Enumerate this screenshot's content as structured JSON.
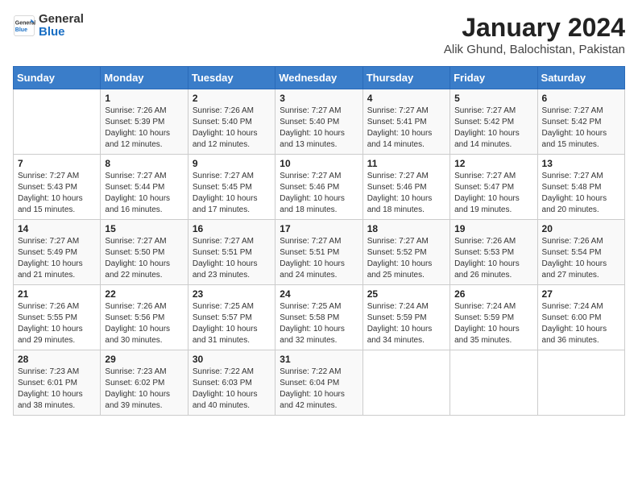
{
  "header": {
    "logo_general": "General",
    "logo_blue": "Blue",
    "month": "January 2024",
    "location": "Alik Ghund, Balochistan, Pakistan"
  },
  "weekdays": [
    "Sunday",
    "Monday",
    "Tuesday",
    "Wednesday",
    "Thursday",
    "Friday",
    "Saturday"
  ],
  "weeks": [
    [
      {
        "day": "",
        "sunrise": "",
        "sunset": "",
        "daylight": ""
      },
      {
        "day": "1",
        "sunrise": "7:26 AM",
        "sunset": "5:39 PM",
        "daylight": "10 hours and 12 minutes."
      },
      {
        "day": "2",
        "sunrise": "7:26 AM",
        "sunset": "5:40 PM",
        "daylight": "10 hours and 12 minutes."
      },
      {
        "day": "3",
        "sunrise": "7:27 AM",
        "sunset": "5:40 PM",
        "daylight": "10 hours and 13 minutes."
      },
      {
        "day": "4",
        "sunrise": "7:27 AM",
        "sunset": "5:41 PM",
        "daylight": "10 hours and 14 minutes."
      },
      {
        "day": "5",
        "sunrise": "7:27 AM",
        "sunset": "5:42 PM",
        "daylight": "10 hours and 14 minutes."
      },
      {
        "day": "6",
        "sunrise": "7:27 AM",
        "sunset": "5:42 PM",
        "daylight": "10 hours and 15 minutes."
      }
    ],
    [
      {
        "day": "7",
        "sunrise": "7:27 AM",
        "sunset": "5:43 PM",
        "daylight": "10 hours and 15 minutes."
      },
      {
        "day": "8",
        "sunrise": "7:27 AM",
        "sunset": "5:44 PM",
        "daylight": "10 hours and 16 minutes."
      },
      {
        "day": "9",
        "sunrise": "7:27 AM",
        "sunset": "5:45 PM",
        "daylight": "10 hours and 17 minutes."
      },
      {
        "day": "10",
        "sunrise": "7:27 AM",
        "sunset": "5:46 PM",
        "daylight": "10 hours and 18 minutes."
      },
      {
        "day": "11",
        "sunrise": "7:27 AM",
        "sunset": "5:46 PM",
        "daylight": "10 hours and 18 minutes."
      },
      {
        "day": "12",
        "sunrise": "7:27 AM",
        "sunset": "5:47 PM",
        "daylight": "10 hours and 19 minutes."
      },
      {
        "day": "13",
        "sunrise": "7:27 AM",
        "sunset": "5:48 PM",
        "daylight": "10 hours and 20 minutes."
      }
    ],
    [
      {
        "day": "14",
        "sunrise": "7:27 AM",
        "sunset": "5:49 PM",
        "daylight": "10 hours and 21 minutes."
      },
      {
        "day": "15",
        "sunrise": "7:27 AM",
        "sunset": "5:50 PM",
        "daylight": "10 hours and 22 minutes."
      },
      {
        "day": "16",
        "sunrise": "7:27 AM",
        "sunset": "5:51 PM",
        "daylight": "10 hours and 23 minutes."
      },
      {
        "day": "17",
        "sunrise": "7:27 AM",
        "sunset": "5:51 PM",
        "daylight": "10 hours and 24 minutes."
      },
      {
        "day": "18",
        "sunrise": "7:27 AM",
        "sunset": "5:52 PM",
        "daylight": "10 hours and 25 minutes."
      },
      {
        "day": "19",
        "sunrise": "7:26 AM",
        "sunset": "5:53 PM",
        "daylight": "10 hours and 26 minutes."
      },
      {
        "day": "20",
        "sunrise": "7:26 AM",
        "sunset": "5:54 PM",
        "daylight": "10 hours and 27 minutes."
      }
    ],
    [
      {
        "day": "21",
        "sunrise": "7:26 AM",
        "sunset": "5:55 PM",
        "daylight": "10 hours and 29 minutes."
      },
      {
        "day": "22",
        "sunrise": "7:26 AM",
        "sunset": "5:56 PM",
        "daylight": "10 hours and 30 minutes."
      },
      {
        "day": "23",
        "sunrise": "7:25 AM",
        "sunset": "5:57 PM",
        "daylight": "10 hours and 31 minutes."
      },
      {
        "day": "24",
        "sunrise": "7:25 AM",
        "sunset": "5:58 PM",
        "daylight": "10 hours and 32 minutes."
      },
      {
        "day": "25",
        "sunrise": "7:24 AM",
        "sunset": "5:59 PM",
        "daylight": "10 hours and 34 minutes."
      },
      {
        "day": "26",
        "sunrise": "7:24 AM",
        "sunset": "5:59 PM",
        "daylight": "10 hours and 35 minutes."
      },
      {
        "day": "27",
        "sunrise": "7:24 AM",
        "sunset": "6:00 PM",
        "daylight": "10 hours and 36 minutes."
      }
    ],
    [
      {
        "day": "28",
        "sunrise": "7:23 AM",
        "sunset": "6:01 PM",
        "daylight": "10 hours and 38 minutes."
      },
      {
        "day": "29",
        "sunrise": "7:23 AM",
        "sunset": "6:02 PM",
        "daylight": "10 hours and 39 minutes."
      },
      {
        "day": "30",
        "sunrise": "7:22 AM",
        "sunset": "6:03 PM",
        "daylight": "10 hours and 40 minutes."
      },
      {
        "day": "31",
        "sunrise": "7:22 AM",
        "sunset": "6:04 PM",
        "daylight": "10 hours and 42 minutes."
      },
      {
        "day": "",
        "sunrise": "",
        "sunset": "",
        "daylight": ""
      },
      {
        "day": "",
        "sunrise": "",
        "sunset": "",
        "daylight": ""
      },
      {
        "day": "",
        "sunrise": "",
        "sunset": "",
        "daylight": ""
      }
    ]
  ]
}
